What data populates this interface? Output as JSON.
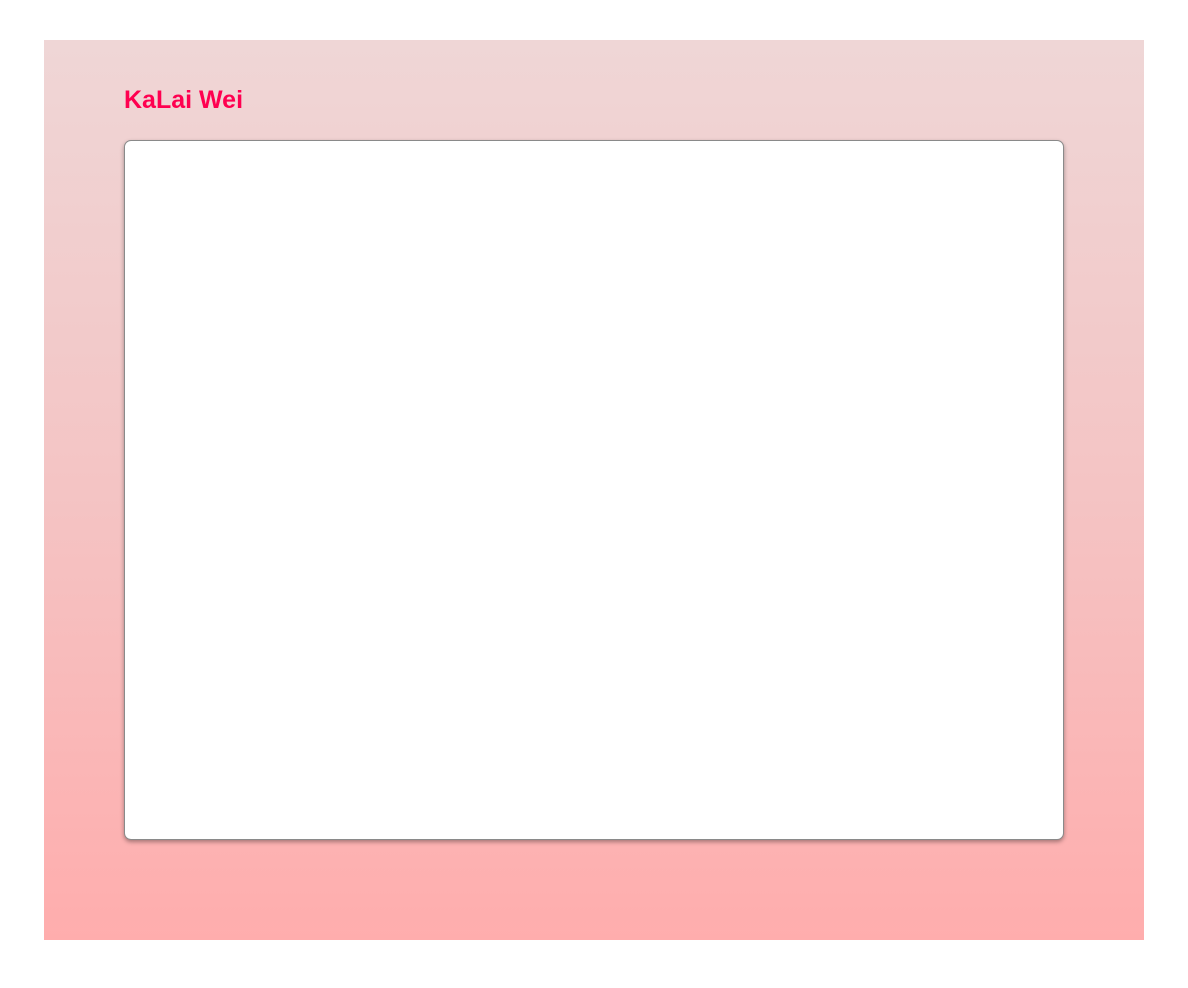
{
  "header": {
    "name": "KaLai Wei"
  },
  "colors": {
    "name_accent": "#ff0050",
    "panel_gradient_top": "#efd6d6",
    "panel_gradient_bottom": "#ffadad",
    "card_background": "#ffffff"
  }
}
